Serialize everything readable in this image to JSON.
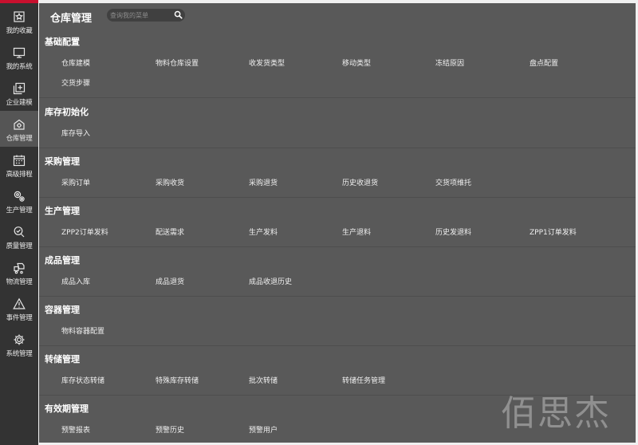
{
  "sidebar": {
    "items": [
      {
        "label": "我的收藏",
        "icon": "star-icon"
      },
      {
        "label": "我的系统",
        "icon": "monitor-icon"
      },
      {
        "label": "企业建模",
        "icon": "add-box-icon"
      },
      {
        "label": "仓库管理",
        "icon": "warehouse-icon"
      },
      {
        "label": "高级排程",
        "icon": "calendar-icon"
      },
      {
        "label": "生产管理",
        "icon": "gears-icon"
      },
      {
        "label": "质量管理",
        "icon": "quality-icon"
      },
      {
        "label": "物流管理",
        "icon": "logistics-icon"
      },
      {
        "label": "事件管理",
        "icon": "warning-icon"
      },
      {
        "label": "系统管理",
        "icon": "gear-icon"
      }
    ],
    "active_index": 3
  },
  "panel": {
    "title": "仓库管理",
    "search_placeholder": "查询我的菜单"
  },
  "sections": [
    {
      "title": "基础配置",
      "items": [
        "仓库建模",
        "物料仓库设置",
        "收发货类型",
        "移动类型",
        "冻结原因",
        "盘点配置",
        "交货步骤"
      ]
    },
    {
      "title": "库存初始化",
      "items": [
        "库存导入"
      ]
    },
    {
      "title": "采购管理",
      "items": [
        "采购订单",
        "采购收货",
        "采购退货",
        "历史收退货",
        "交货项维托"
      ]
    },
    {
      "title": "生产管理",
      "items": [
        "ZPP2订单发料",
        "配送需求",
        "生产发料",
        "生产退料",
        "历史发退料",
        "ZPP1订单发料"
      ]
    },
    {
      "title": "成品管理",
      "items": [
        "成品入库",
        "成品退货",
        "成品收退历史"
      ]
    },
    {
      "title": "容器管理",
      "items": [
        "物料容器配置"
      ]
    },
    {
      "title": "转储管理",
      "items": [
        "库存状态转储",
        "特殊库存转储",
        "批次转储",
        "转储任务管理"
      ]
    },
    {
      "title": "有效期管理",
      "items": [
        "预警报表",
        "预警历史",
        "预警用户"
      ]
    }
  ],
  "watermark": "佰思杰"
}
